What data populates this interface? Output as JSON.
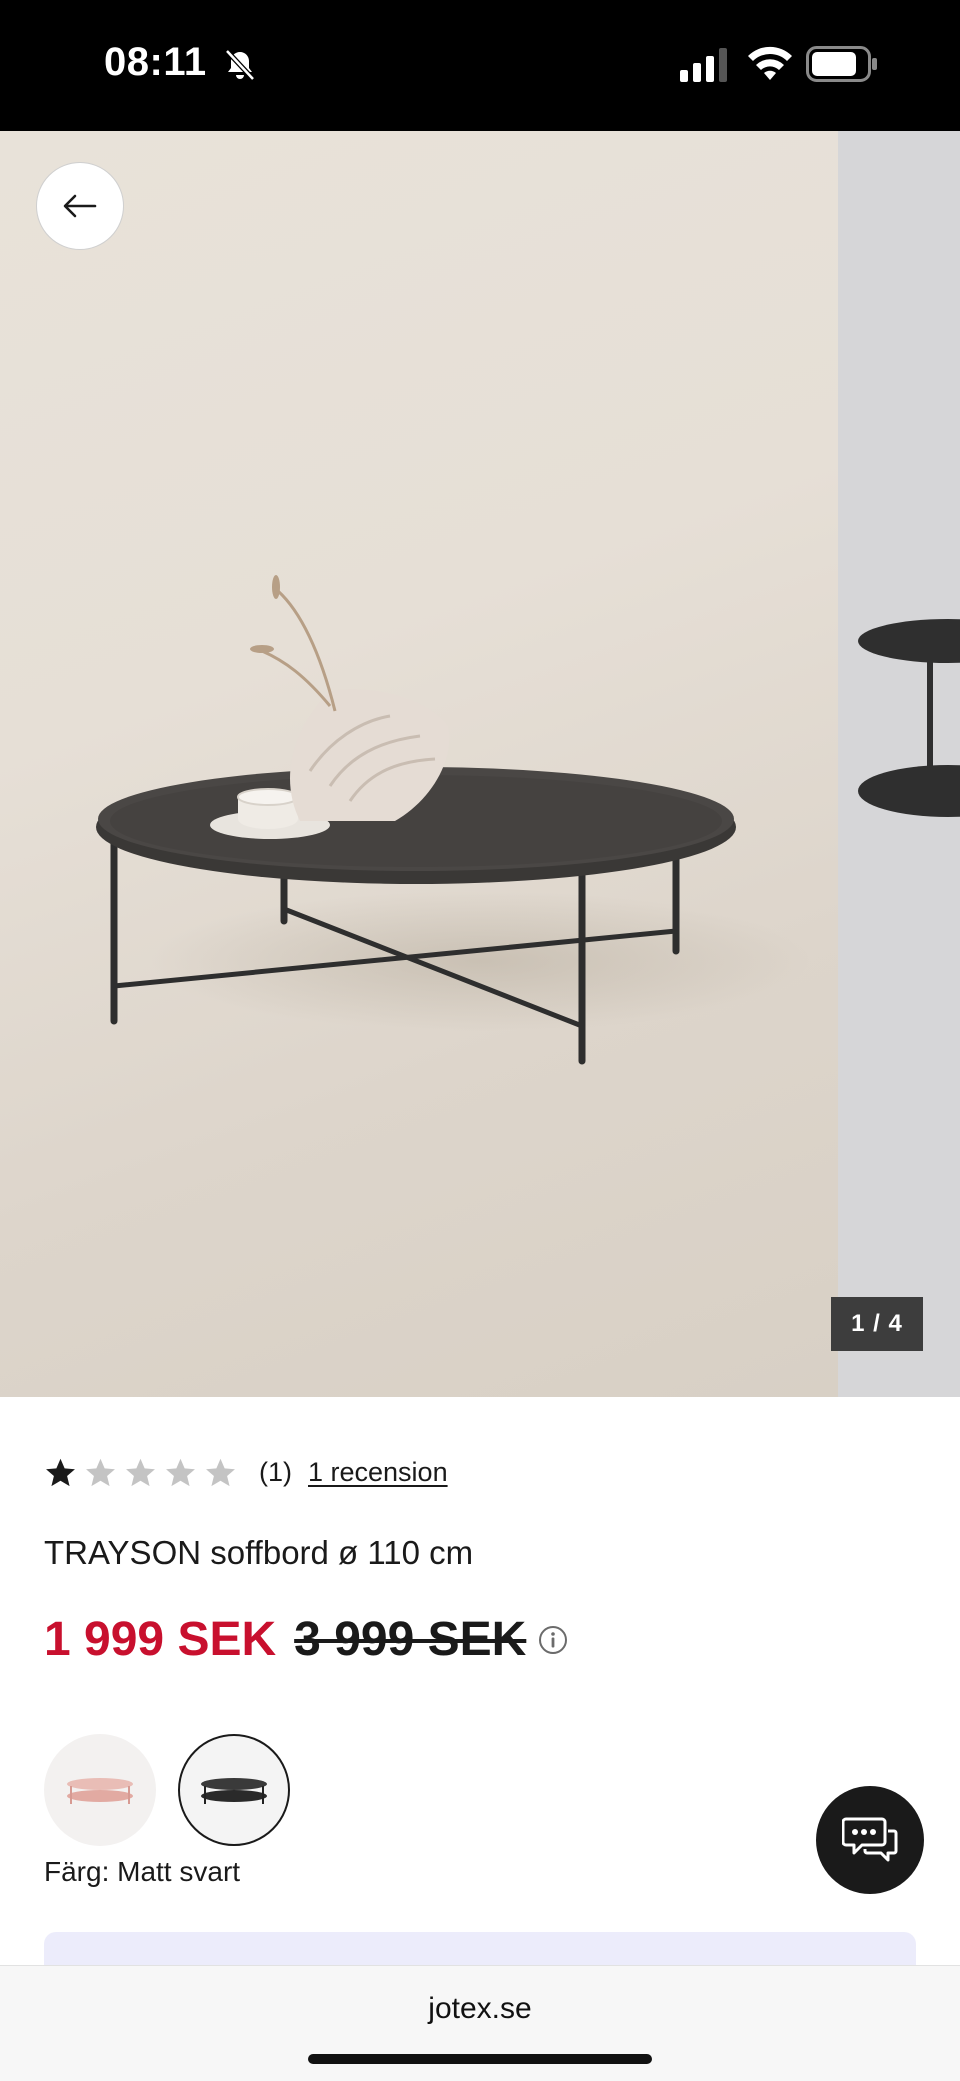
{
  "status_bar": {
    "time": "08:11",
    "icons": [
      "bell-slash-icon",
      "cellular-signal-icon",
      "wifi-icon",
      "battery-icon"
    ]
  },
  "gallery": {
    "counter": "1 / 4",
    "current_image": 1,
    "total_images": 4
  },
  "product": {
    "rating": 1,
    "rating_max": 5,
    "rating_count": "(1)",
    "reviews_link": "1 recension",
    "title": "TRAYSON soffbord ø 110 cm",
    "price_current": "1 999 SEK",
    "price_original": "3 999 SEK",
    "color_label": "Färg: Matt svart",
    "swatches": [
      {
        "name": "rosa",
        "selected": false,
        "color": "#e7b9b4"
      },
      {
        "name": "matt-svart",
        "selected": true,
        "color": "#3a3a3a"
      }
    ]
  },
  "browser": {
    "url": "jotex.se"
  },
  "colors": {
    "sale_price": "#c8102e",
    "text": "#1a1a1a",
    "promo_strip": "#ececfb"
  }
}
